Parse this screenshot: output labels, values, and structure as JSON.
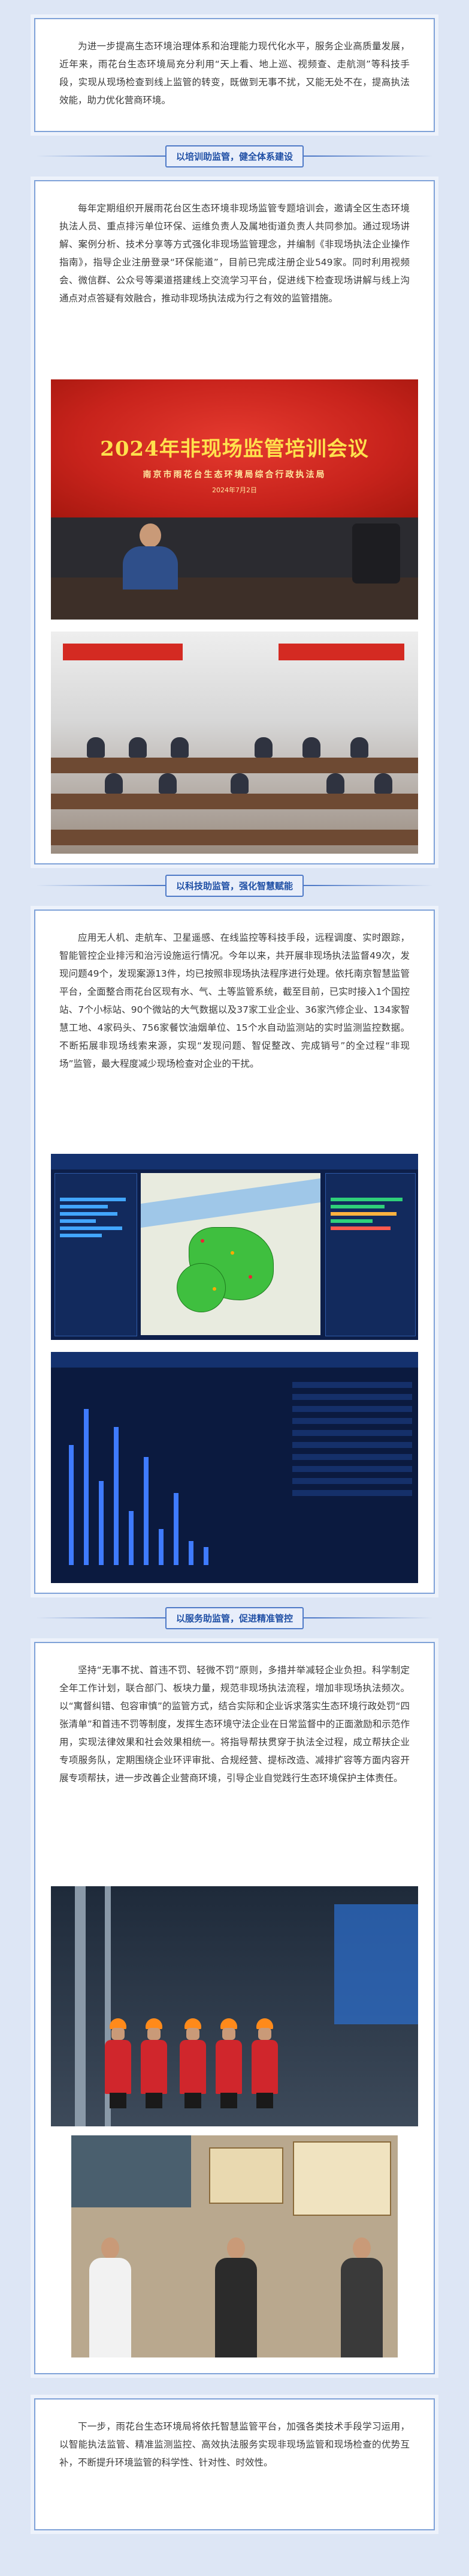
{
  "intro": {
    "text": "为进一步提高生态环境治理体系和治理能力现代化水平，服务企业高质量发展，近年来，雨花台生态环境局充分利用“天上看、地上巡、视频查、走航测”等科技手段，实现从现场检查到线上监管的转变，既做到无事不扰，又能无处不在，提高执法效能，助力优化营商环境。"
  },
  "sections": [
    {
      "heading": "以培训助监管，健全体系建设",
      "text": "每年定期组织开展雨花台区生态环境非现场监管专题培训会，邀请全区生态环境执法人员、重点排污单位环保、运维负责人及属地街道负责人共同参加。通过现场讲解、案例分析、技术分享等方式强化非现场监管理念，并编制《非现场执法企业操作指南》，指导企业注册登录“环保能道”，目前已完成注册企业549家。同时利用视频会、微信群、公众号等渠道搭建线上交流学习平台，促进线下检查现场讲解与线上沟通点对点答疑有效融合，推动非现场执法成为行之有效的监管措施。"
    },
    {
      "heading": "以科技助监管，强化智慧赋能",
      "text": "应用无人机、走航车、卫星遥感、在线监控等科技手段，远程调度、实时跟踪，智能管控企业排污和治污设施运行情况。今年以来，共开展非现场执法监督49次，发现问题49个，发现案源13件，均已按照非现场执法程序进行处理。依托南京智慧监管平台，全面整合雨花台区现有水、气、土等监管系统，截至目前，已实时接入1个国控站、7个小标站、90个微站的大气数据以及37家工业企业、36家汽修企业、134家智慧工地、4家码头、756家餐饮油烟单位、15个水自动监测站的实时监测监控数据。不断拓展非现场线索来源，实现“发现问题、智促整改、完成销号”的全过程“非现场”监管，最大程度减少现场检查对企业的干扰。"
    },
    {
      "heading": "以服务助监管，促进精准管控",
      "text": "坚持“无事不扰、首违不罚、轻微不罚”原则，多措并举减轻企业负担。科学制定全年工作计划，联合部门、板块力量，规范非现场执法流程，增加非现场执法频次。以“寓督纠错、包容审慎”的监管方式，结合实际和企业诉求落实生态环境行政处罚“四张清单”和首违不罚等制度，发挥生态环境守法企业在日常监督中的正面激励和示范作用，实现法律效果和社会效果相统一。将指导帮扶贯穿于执法全过程，成立帮扶企业专项服务队，定期围绕企业环评审批、合规经营、提标改造、减排扩容等方面内容开展专项帮扶，进一步改善企业营商环境，引导企业自觉践行生态环境保护主体责任。"
    }
  ],
  "photos": {
    "meeting_banner_title": "2024年非现场监管培训会议",
    "meeting_banner_org": "南京市雨花台生态环境局综合行政执法局",
    "meeting_banner_date": "2024年7月2日"
  },
  "closing": {
    "text": "下一步，雨花台生态环境局将依托智慧监管平台，加强各类技术手段学习运用，以智能执法监管、精准监测监控、高效执法服务实现非现场监管和现场检查的优势互补，不断提升环境监管的科学性、针对性、时效性。"
  },
  "colors": {
    "page_bg": "#dde6f5",
    "border": "#7fa2d8",
    "heading_blue": "#1f4fa5",
    "banner_red": "#c8231c"
  }
}
